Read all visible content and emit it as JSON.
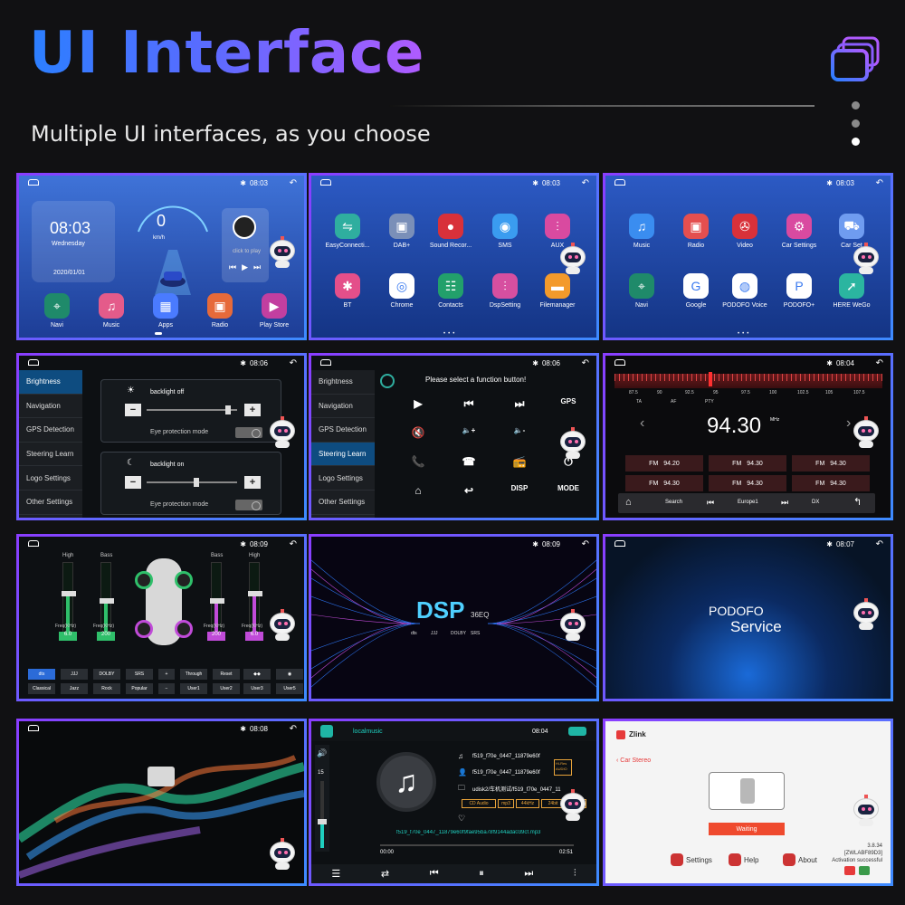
{
  "header": {
    "title": "UI Interface",
    "subtitle": "Multiple UI interfaces, as you choose"
  },
  "colors": {
    "accent_blue": "#2b7fff",
    "accent_purple": "#b05bff",
    "dot_inactive": "#8a8a8a",
    "dot_active": "#ffffff"
  },
  "panel1": {
    "time": "08:03",
    "clock": "08:03",
    "weekday": "Wednesday",
    "date": "2020/01/01",
    "speed": "0",
    "speed_unit": "km/h",
    "music_hint": "click to play",
    "dock": [
      {
        "label": "Navi",
        "icon": "map-pin-icon",
        "color": "#1f8a6a"
      },
      {
        "label": "Music",
        "icon": "music-note-icon",
        "color": "#e45b8a"
      },
      {
        "label": "Apps",
        "icon": "grid-icon",
        "color": "#4a7bff"
      },
      {
        "label": "Radio",
        "icon": "radio-icon",
        "color": "#e66a3a"
      },
      {
        "label": "Play Store",
        "icon": "play-store-icon",
        "color": "#c23fa0"
      }
    ]
  },
  "panel2": {
    "time": "08:03",
    "apps": [
      {
        "label": "EasyConnecti...",
        "icon": "link-icon",
        "color": "#2fae9f"
      },
      {
        "label": "DAB+",
        "icon": "radio-icon",
        "color": "#7a8fb8"
      },
      {
        "label": "Sound Recor...",
        "icon": "microphone-icon",
        "color": "#d8313a"
      },
      {
        "label": "SMS",
        "icon": "chat-icon",
        "color": "#3a9cf0"
      },
      {
        "label": "AUX",
        "icon": "equalizer-icon",
        "color": "#d94aa0"
      },
      {
        "label": "BT",
        "icon": "bluetooth-icon",
        "color": "#e44f8a"
      },
      {
        "label": "Chrome",
        "icon": "chrome-icon",
        "color": "#ffffff"
      },
      {
        "label": "Contacts",
        "icon": "contacts-icon",
        "color": "#22a06b"
      },
      {
        "label": "DspSetting",
        "icon": "dsp-icon",
        "color": "#d64fa0"
      },
      {
        "label": "Filemanager",
        "icon": "folder-icon",
        "color": "#f39a2b"
      }
    ]
  },
  "panel3": {
    "time": "08:03",
    "apps": [
      {
        "label": "Music",
        "icon": "music-note-icon",
        "color": "#3a8df0"
      },
      {
        "label": "Radio",
        "icon": "radio-icon",
        "color": "#e44f4f"
      },
      {
        "label": "Video",
        "icon": "film-icon",
        "color": "#d8313a"
      },
      {
        "label": "Car Settings",
        "icon": "gear-icon",
        "color": "#d94aa0"
      },
      {
        "label": "Car Set",
        "icon": "car-icon",
        "color": "#6f9cf0"
      },
      {
        "label": "Navi",
        "icon": "map-pin-icon",
        "color": "#1f8a6a"
      },
      {
        "label": "Google",
        "icon": "google-icon",
        "color": "#ffffff"
      },
      {
        "label": "PODOFO Voice",
        "icon": "podofo-voice-icon",
        "color": "#ffffff"
      },
      {
        "label": "PODOFO+",
        "icon": "podofo-plus-icon",
        "color": "#ffffff"
      },
      {
        "label": "HERE WeGo",
        "icon": "here-wego-icon",
        "color": "#2bb5a0"
      }
    ]
  },
  "panel4": {
    "time": "08:06",
    "menu": [
      "Brightness",
      "Navigation",
      "GPS Detection",
      "Steering Learn",
      "Logo Settings",
      "Other Settings"
    ],
    "card1_label": "backlight off",
    "card1_mode": "Eye protection mode",
    "card2_label": "backlight on",
    "card2_mode": "Eye protection mode",
    "card1_level": 0.9,
    "card2_level": 0.55
  },
  "panel5": {
    "time": "08:06",
    "prompt": "Please select a function button!",
    "menu": [
      "Brightness",
      "Navigation",
      "GPS Detection",
      "Steering Learn",
      "Logo Settings",
      "Other Settings"
    ],
    "selected": "Steering Learn",
    "buttons": [
      "▶",
      "⏮",
      "⏭",
      "GPS",
      "🔇",
      "🔈+",
      "🔈-",
      "",
      "📞",
      "☎",
      "📻",
      "⏻",
      "⌂",
      "↩",
      "DISP",
      "MODE"
    ]
  },
  "panel6": {
    "time": "08:04",
    "scale": [
      "87.5",
      "90",
      "92.5",
      "95",
      "97.5",
      "100",
      "102.5",
      "105",
      "107.5"
    ],
    "flags": [
      "TA",
      "AF",
      "PTY"
    ],
    "freq": "94.30",
    "freq_unit": "MHz",
    "presets": [
      {
        "band": "FM",
        "freq": "94.20"
      },
      {
        "band": "FM",
        "freq": "94.30"
      },
      {
        "band": "FM",
        "freq": "94.30"
      },
      {
        "band": "FM",
        "freq": "94.30"
      },
      {
        "band": "FM",
        "freq": "94.30"
      },
      {
        "band": "FM",
        "freq": "94.30"
      }
    ],
    "bottom": {
      "search": "Search",
      "region": "Europe1",
      "dx": "DX"
    }
  },
  "panel7": {
    "time": "08:09",
    "left_labels": [
      "High",
      "Bass"
    ],
    "right_labels": [
      "Bass",
      "High"
    ],
    "freq_label": "Freq(KHz)",
    "values": [
      "6.0",
      "200",
      "200",
      "6.0"
    ],
    "slider_levels": [
      0.55,
      0.45,
      0.45,
      0.55
    ],
    "row1": [
      "dts",
      "JJJ",
      "DOLBY",
      "SRS",
      "+",
      "Through",
      "Reset",
      "◆◆",
      "◉"
    ],
    "row2": [
      "Classical",
      "Jazz",
      "Rock",
      "Popular",
      "−",
      "User1",
      "User2",
      "User3",
      "User5"
    ]
  },
  "panel8": {
    "time": "08:09",
    "title": "DSP",
    "suffix": "36EQ",
    "logos": [
      "dts",
      "JJJ",
      "DOLBY",
      "SRS"
    ]
  },
  "panel9": {
    "time": "08:07",
    "brand": "PODOFO",
    "service": "Service"
  },
  "panel10": {
    "time": "08:08"
  },
  "panel11": {
    "app": "localmusic",
    "time": "08:04",
    "volume": "15",
    "track": "f519_f70e_0447_11879e60f",
    "track2": "f519_f70e_0447_11879e60f",
    "path": "udisk2/车机测试/f519_f70e_0447_11",
    "badges": [
      "CD Audio",
      "mp3",
      "44kHz",
      "24bit",
      "2112"
    ],
    "hires": "Hi-Res AUDIO",
    "full_name": "f519_f70e_0447_11879e60f9fae95ba78f9144ada039cf.mp3",
    "elapsed": "00:00",
    "duration": "02:51",
    "progress": 0.0
  },
  "panel12": {
    "brand": "Zlink",
    "back": "Car Stereo",
    "status": "Waiting",
    "version": "3.8.34",
    "code": "[ZWLABF89D3]",
    "activation": "Activation successful",
    "buttons": [
      "Settings",
      "Help",
      "About"
    ]
  }
}
